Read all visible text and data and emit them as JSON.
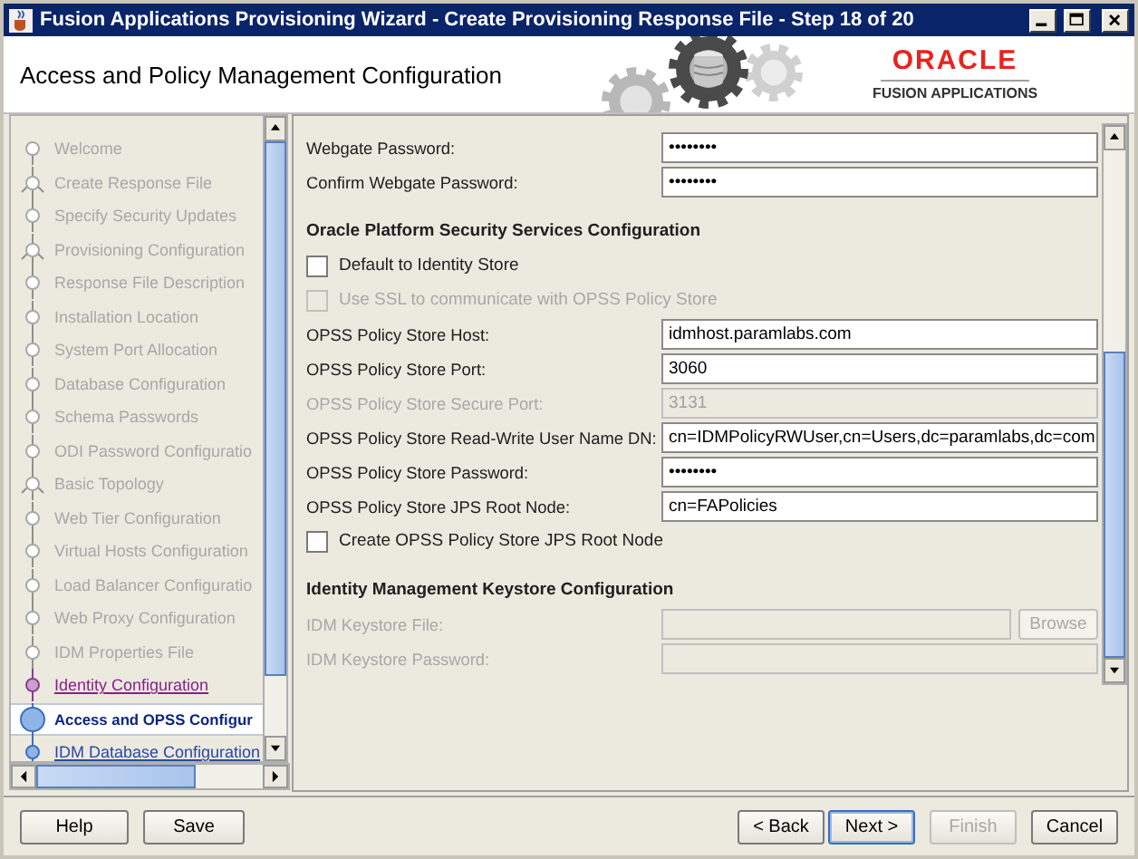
{
  "window": {
    "title": "Fusion Applications Provisioning Wizard - Create Provisioning Response File - Step 18 of 20"
  },
  "header": {
    "title": "Access and Policy Management Configuration",
    "brand": "ORACLE",
    "product": "FUSION APPLICATIONS"
  },
  "steps": [
    {
      "label": "Welcome",
      "kind": "done",
      "selected": false
    },
    {
      "label": "Create Response File",
      "kind": "fork",
      "selected": false
    },
    {
      "label": "Specify Security Updates",
      "kind": "done",
      "selected": false
    },
    {
      "label": "Provisioning Configuration",
      "kind": "fork",
      "selected": false
    },
    {
      "label": "Response File Description",
      "kind": "done",
      "selected": false
    },
    {
      "label": "Installation Location",
      "kind": "done",
      "selected": false
    },
    {
      "label": "System Port Allocation",
      "kind": "done",
      "selected": false
    },
    {
      "label": "Database Configuration",
      "kind": "done",
      "selected": false
    },
    {
      "label": "Schema Passwords",
      "kind": "done",
      "selected": false
    },
    {
      "label": "ODI Password Configuratio",
      "kind": "done",
      "selected": false
    },
    {
      "label": "Basic Topology",
      "kind": "fork",
      "selected": false
    },
    {
      "label": "Web Tier Configuration",
      "kind": "done",
      "selected": false
    },
    {
      "label": "Virtual Hosts Configuration",
      "kind": "done",
      "selected": false
    },
    {
      "label": "Load Balancer Configuratio",
      "kind": "done",
      "selected": false
    },
    {
      "label": "Web Proxy Configuration",
      "kind": "done",
      "selected": false
    },
    {
      "label": "IDM Properties File",
      "kind": "done",
      "selected": false
    },
    {
      "label": "Identity Configuration",
      "kind": "visited",
      "selected": false
    },
    {
      "label": "Access and OPSS Configur",
      "kind": "upcoming",
      "selected": true
    },
    {
      "label": "IDM Database Configuration",
      "kind": "upcoming",
      "selected": false
    }
  ],
  "form": [
    {
      "kind": "field",
      "label": "Webgate Password:",
      "value": "••••••••",
      "disabled": false
    },
    {
      "kind": "field",
      "label": "Confirm Webgate Password:",
      "value": "••••••••",
      "disabled": false
    },
    {
      "kind": "heading",
      "label": "Oracle Platform Security Services Configuration"
    },
    {
      "kind": "checkbox",
      "label": "Default to Identity Store",
      "checked": false,
      "disabled": false
    },
    {
      "kind": "checkbox",
      "label": "Use SSL to communicate with OPSS Policy Store",
      "checked": false,
      "disabled": true
    },
    {
      "kind": "field",
      "label": "OPSS Policy Store Host:",
      "value": "idmhost.paramlabs.com",
      "disabled": false
    },
    {
      "kind": "field",
      "label": "OPSS Policy Store Port:",
      "value": "3060",
      "disabled": false
    },
    {
      "kind": "field",
      "label": "OPSS Policy Store Secure Port:",
      "value": "3131",
      "disabled": true
    },
    {
      "kind": "field",
      "label": "OPSS Policy Store Read-Write User Name DN:",
      "value": "cn=IDMPolicyRWUser,cn=Users,dc=paramlabs,dc=com",
      "disabled": false
    },
    {
      "kind": "field",
      "label": "OPSS Policy Store Password:",
      "value": "••••••••",
      "disabled": false
    },
    {
      "kind": "field",
      "label": "OPSS Policy Store JPS Root Node:",
      "value": "cn=FAPolicies",
      "disabled": false
    },
    {
      "kind": "checkbox",
      "label": "Create OPSS Policy Store JPS Root Node",
      "checked": false,
      "disabled": false
    },
    {
      "kind": "heading",
      "label": "Identity Management Keystore Configuration"
    },
    {
      "kind": "file",
      "label": "IDM Keystore File:",
      "button": "Browse",
      "disabled": true
    },
    {
      "kind": "field",
      "label": "IDM Keystore Password:",
      "disabled": true
    }
  ],
  "buttons_left": [
    {
      "label": "Help",
      "disabled": false,
      "default": false
    },
    {
      "label": "Save",
      "disabled": false,
      "default": false
    }
  ],
  "buttons_right": [
    {
      "label": "< Back",
      "disabled": false,
      "default": false
    },
    {
      "label": "Next >",
      "disabled": false,
      "default": true
    },
    {
      "label": "Finish",
      "disabled": true,
      "default": false
    },
    {
      "label": "Cancel",
      "disabled": false,
      "default": false
    }
  ]
}
